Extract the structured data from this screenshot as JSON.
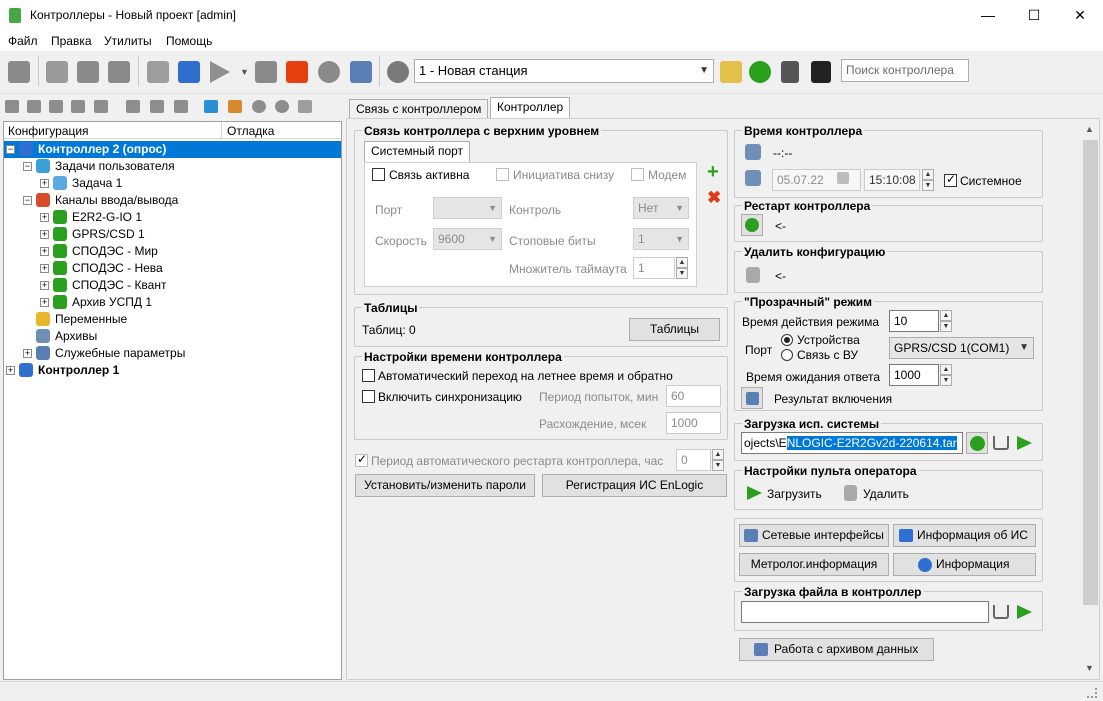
{
  "window": {
    "title": "Контроллеры - Новый проект [admin]",
    "minimize": "—",
    "maximize": "☐",
    "close": "✕"
  },
  "menu": [
    "Файл",
    "Правка",
    "Утилиты",
    "Помощь"
  ],
  "toolbar": {
    "station": "1 - Новая станция",
    "search_placeholder": "Поиск контроллера"
  },
  "tree": {
    "headers": [
      "Конфигурация",
      "Отладка"
    ],
    "items": [
      {
        "label": "Контроллер 2 (опрос)",
        "level": 0,
        "expander": "−",
        "selected": true,
        "bold": true
      },
      {
        "label": "Задачи пользователя",
        "level": 1,
        "expander": "−"
      },
      {
        "label": "Задача 1",
        "level": 2,
        "expander": "+"
      },
      {
        "label": "Каналы ввода/вывода",
        "level": 1,
        "expander": "−"
      },
      {
        "label": "E2R2-G-IO 1",
        "level": 2,
        "expander": "+"
      },
      {
        "label": "GPRS/CSD 1",
        "level": 2,
        "expander": "+"
      },
      {
        "label": "СПОДЭС - Мир",
        "level": 2,
        "expander": "+"
      },
      {
        "label": "СПОДЭС - Нева",
        "level": 2,
        "expander": "+"
      },
      {
        "label": "СПОДЭС - Квант",
        "level": 2,
        "expander": "+"
      },
      {
        "label": "Архив УСПД 1",
        "level": 2,
        "expander": "+"
      },
      {
        "label": "Переменные",
        "level": 1,
        "expander": ""
      },
      {
        "label": "Архивы",
        "level": 1,
        "expander": ""
      },
      {
        "label": "Служебные параметры",
        "level": 1,
        "expander": "+"
      },
      {
        "label": "Контроллер 1",
        "level": 0,
        "expander": "+",
        "bold": true
      }
    ]
  },
  "tabs": [
    "Связь с контроллером",
    "Контроллер"
  ],
  "link": {
    "title": "Связь контроллера с верхним уровнем",
    "subtab": "Системный порт",
    "active_label": "Связь активна",
    "initiative_label": "Инициатива снизу",
    "modem_label": "Модем",
    "port_label": "Порт",
    "control_label": "Контроль",
    "control_value": "Нет",
    "speed_label": "Скорость",
    "speed_value": "9600",
    "stopbits_label": "Стоповые биты",
    "stopbits_value": "1",
    "timeout_label": "Множитель таймаута",
    "timeout_value": "1"
  },
  "tables": {
    "title": "Таблицы",
    "count_label": "Таблиц: 0",
    "button": "Таблицы"
  },
  "timeset": {
    "title": "Настройки времени контроллера",
    "dst_label": "Автоматический переход на летнее время и обратно",
    "sync_label": "Включить синхронизацию",
    "period_label": "Период попыток, мин",
    "period_value": "60",
    "diff_label": "Расхождение, мсек",
    "diff_value": "1000"
  },
  "restart_period": {
    "label": "Период автоматического рестарта контроллера, час",
    "value": "0"
  },
  "buttons": {
    "passwords": "Установить/изменить пароли",
    "register": "Регистрация ИС EnLogic"
  },
  "ctime": {
    "title": "Время контроллера",
    "current": "--:--",
    "date": "05.07.22",
    "time": "15:10:08",
    "system_label": "Системное"
  },
  "restart": {
    "title": "Рестарт контроллера",
    "value": "<-"
  },
  "delete_conf": {
    "title": "Удалить конфигурацию",
    "value": "<-"
  },
  "transparent": {
    "title": "\"Прозрачный\" режим",
    "duration_label": "Время действия режима",
    "duration_value": "10",
    "port_label": "Порт",
    "radio_devices": "Устройства",
    "radio_vu": "Связь с ВУ",
    "port_value": "GPRS/CSD 1(COM1)",
    "wait_label": "Время ожидания ответа",
    "wait_value": "1000",
    "result_label": "Результат включения"
  },
  "sysload": {
    "title": "Загрузка исп. системы",
    "path_prefix": "ojects\\E",
    "path_selected": "NLOGIC-E2R2Gv2d-220614.tar"
  },
  "panel_settings": {
    "title": "Настройки пульта оператора",
    "load": "Загрузить",
    "delete": "Удалить"
  },
  "info_buttons": {
    "net": "Сетевые интерфейсы",
    "is_info": "Информация об ИС",
    "metro": "Метролог.информация",
    "info": "Информация"
  },
  "fileload": {
    "title": "Загрузка файла в контроллер",
    "value": ""
  },
  "archive_button": "Работа с архивом данных",
  "colors": {
    "selection": "#0078d7",
    "accent_green": "#2aa01e",
    "stop_red": "#e6400f"
  }
}
